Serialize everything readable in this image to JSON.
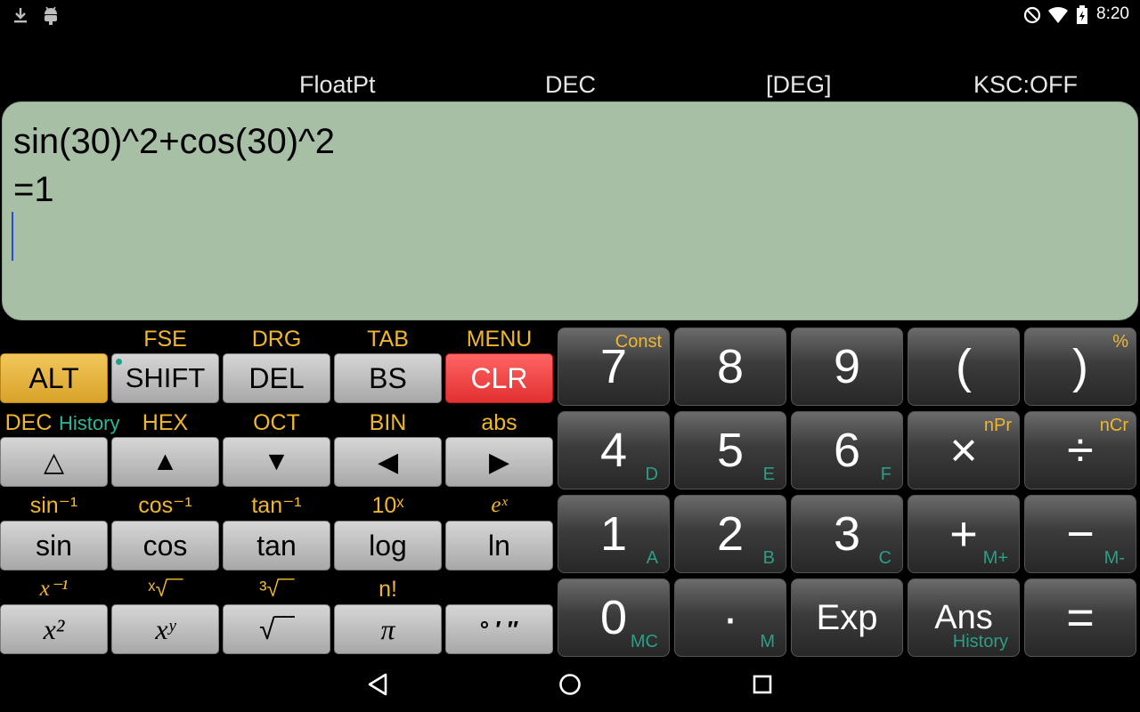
{
  "status_bar": {
    "time": "8:20"
  },
  "mode_bar": {
    "format": "FloatPt",
    "base": "DEC",
    "angle": "[DEG]",
    "ksc": "KSC:OFF"
  },
  "display": {
    "expression": "sin(30)^2+cos(30)^2",
    "result": "=1"
  },
  "function_keys": {
    "row1": {
      "labels": [
        "ALT",
        "SHIFT",
        "DEL",
        "BS",
        "CLR"
      ],
      "secondary": [
        "",
        "FSE",
        "DRG",
        "TAB",
        "MENU"
      ]
    },
    "row2": {
      "labels": [
        "△",
        "▲",
        "▼",
        "◀",
        "▶"
      ],
      "secondary": [
        "DEC",
        "HEX",
        "OCT",
        "BIN",
        "abs"
      ],
      "history_label": "History"
    },
    "row3": {
      "labels": [
        "sin",
        "cos",
        "tan",
        "log",
        "ln"
      ],
      "secondary": [
        "sin⁻¹",
        "cos⁻¹",
        "tan⁻¹",
        "10ˣ",
        "eˣ"
      ]
    },
    "row4": {
      "labels": [
        "x²",
        "xʸ",
        "√‾‾",
        "π",
        "° ′ ″"
      ],
      "secondary": [
        "x⁻¹",
        "ˣ√‾‾",
        "³√‾‾",
        "n!",
        ""
      ]
    }
  },
  "numeric_keys": {
    "row1": [
      {
        "main": "7",
        "sup": "Const",
        "sub": ""
      },
      {
        "main": "8",
        "sup": "",
        "sub": ""
      },
      {
        "main": "9",
        "sup": "",
        "sub": ""
      },
      {
        "main": "(",
        "sup": "",
        "sub": ""
      },
      {
        "main": ")",
        "sup": "%",
        "sub": ""
      }
    ],
    "row2": [
      {
        "main": "4",
        "sup": "",
        "sub": "D"
      },
      {
        "main": "5",
        "sup": "",
        "sub": "E"
      },
      {
        "main": "6",
        "sup": "",
        "sub": "F"
      },
      {
        "main": "×",
        "sup": "nPr",
        "sub": ""
      },
      {
        "main": "÷",
        "sup": "nCr",
        "sub": ""
      }
    ],
    "row3": [
      {
        "main": "1",
        "sup": "",
        "sub": "A"
      },
      {
        "main": "2",
        "sup": "",
        "sub": "B"
      },
      {
        "main": "3",
        "sup": "",
        "sub": "C"
      },
      {
        "main": "+",
        "sup": "",
        "sub": "M+"
      },
      {
        "main": "−",
        "sup": "",
        "sub": "M-"
      }
    ],
    "row4": [
      {
        "main": "0",
        "sup": "",
        "sub": "MC"
      },
      {
        "main": "·",
        "sup": "",
        "sub": "M"
      },
      {
        "main": "Exp",
        "sup": "",
        "sub": ""
      },
      {
        "main": "Ans",
        "sup": "",
        "sub": "History"
      },
      {
        "main": "=",
        "sup": "",
        "sub": ""
      }
    ]
  },
  "colors": {
    "display_bg": "#a7bfa5",
    "alt_key": "#e8b93f",
    "clr_key": "#f04444",
    "secondary_label": "#f0b72d",
    "hex_label": "#2c9e86"
  }
}
